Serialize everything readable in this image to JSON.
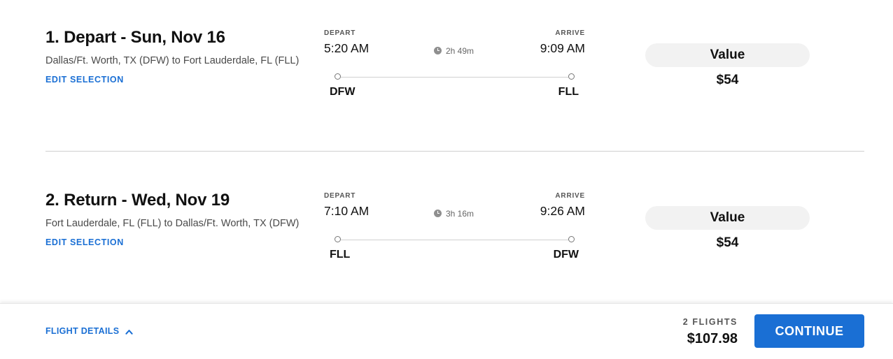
{
  "flights": [
    {
      "title": "1. Depart - Sun, Nov 16",
      "route": "Dallas/Ft. Worth, TX (DFW) to Fort Lauderdale, FL (FLL)",
      "edit_label": "EDIT SELECTION",
      "depart_caption": "DEPART",
      "arrive_caption": "ARRIVE",
      "depart_time": "5:20 AM",
      "arrive_time": "9:09 AM",
      "duration": "2h 49m",
      "from_code": "DFW",
      "to_code": "FLL",
      "fare_name": "Value",
      "fare_price": "$54"
    },
    {
      "title": "2. Return - Wed, Nov 19",
      "route": "Fort Lauderdale, FL (FLL) to Dallas/Ft. Worth, TX (DFW)",
      "edit_label": "EDIT SELECTION",
      "depart_caption": "DEPART",
      "arrive_caption": "ARRIVE",
      "depart_time": "7:10 AM",
      "arrive_time": "9:26 AM",
      "duration": "3h 16m",
      "from_code": "FLL",
      "to_code": "DFW",
      "fare_name": "Value",
      "fare_price": "$54"
    }
  ],
  "footer": {
    "details_label": "FLIGHT DETAILS",
    "details_icon": "chevron-up-icon",
    "flight_count": "2 FLIGHTS",
    "total": "$107.98",
    "continue_label": "CONTINUE"
  },
  "colors": {
    "accent": "#1a6fd4",
    "fare_pill": "#f2f2f2",
    "divider": "#cfcfcf"
  }
}
